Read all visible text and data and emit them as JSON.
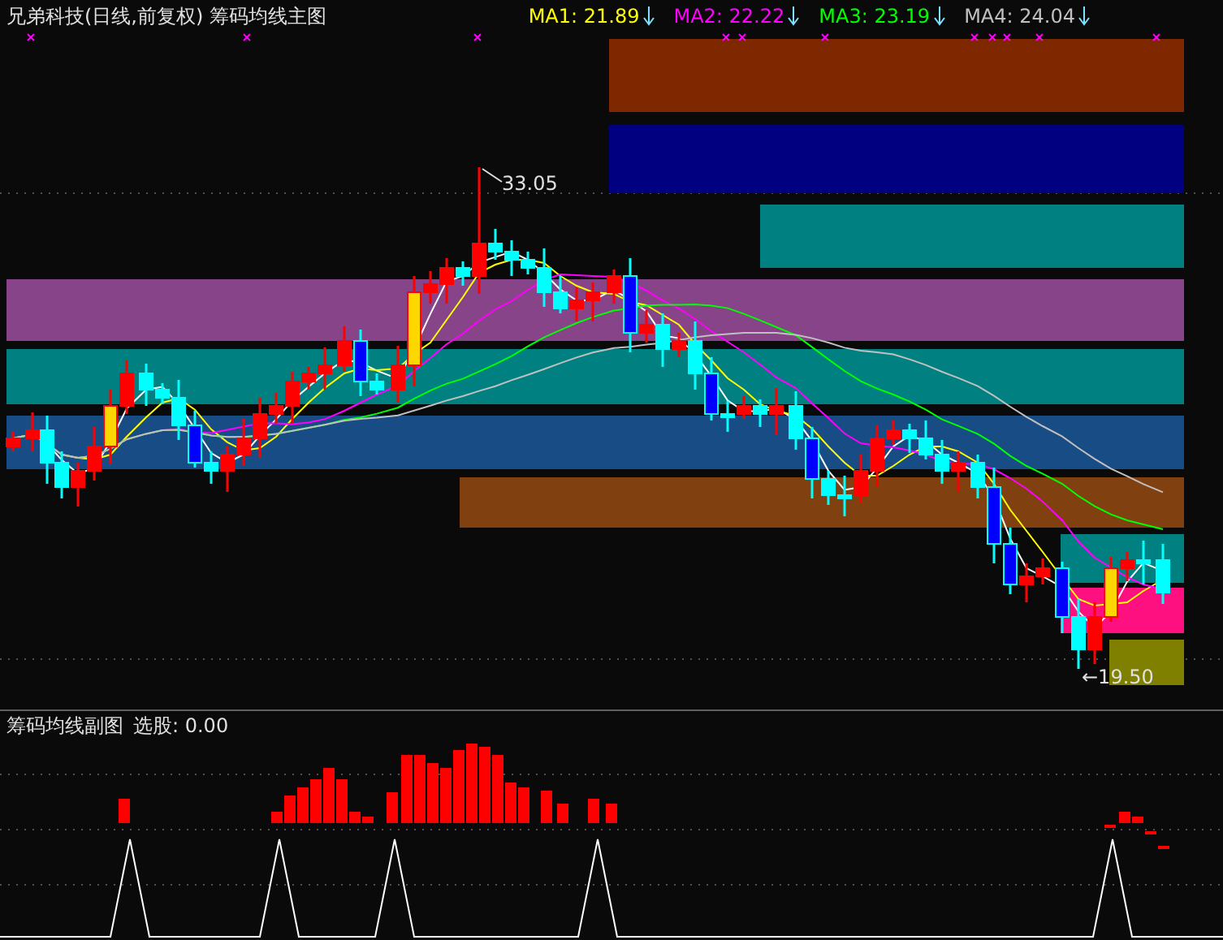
{
  "title": "兄弟科技(日线,前复权) 筹码均线主图",
  "ma_labels": [
    {
      "label": "MA1: 21.89",
      "color": "#ffff00"
    },
    {
      "label": "MA2: 22.22",
      "color": "#ff00ff"
    },
    {
      "label": "MA3: 23.19",
      "color": "#00ff00"
    },
    {
      "label": "MA4: 24.04",
      "color": "#c0c0c0"
    }
  ],
  "price_labels": [
    {
      "kind": "high",
      "text": "33.05"
    },
    {
      "kind": "low",
      "text": "←19.50"
    }
  ],
  "sub_chart": {
    "title": "筹码均线副图",
    "reading": "选股: 0.00"
  }
}
